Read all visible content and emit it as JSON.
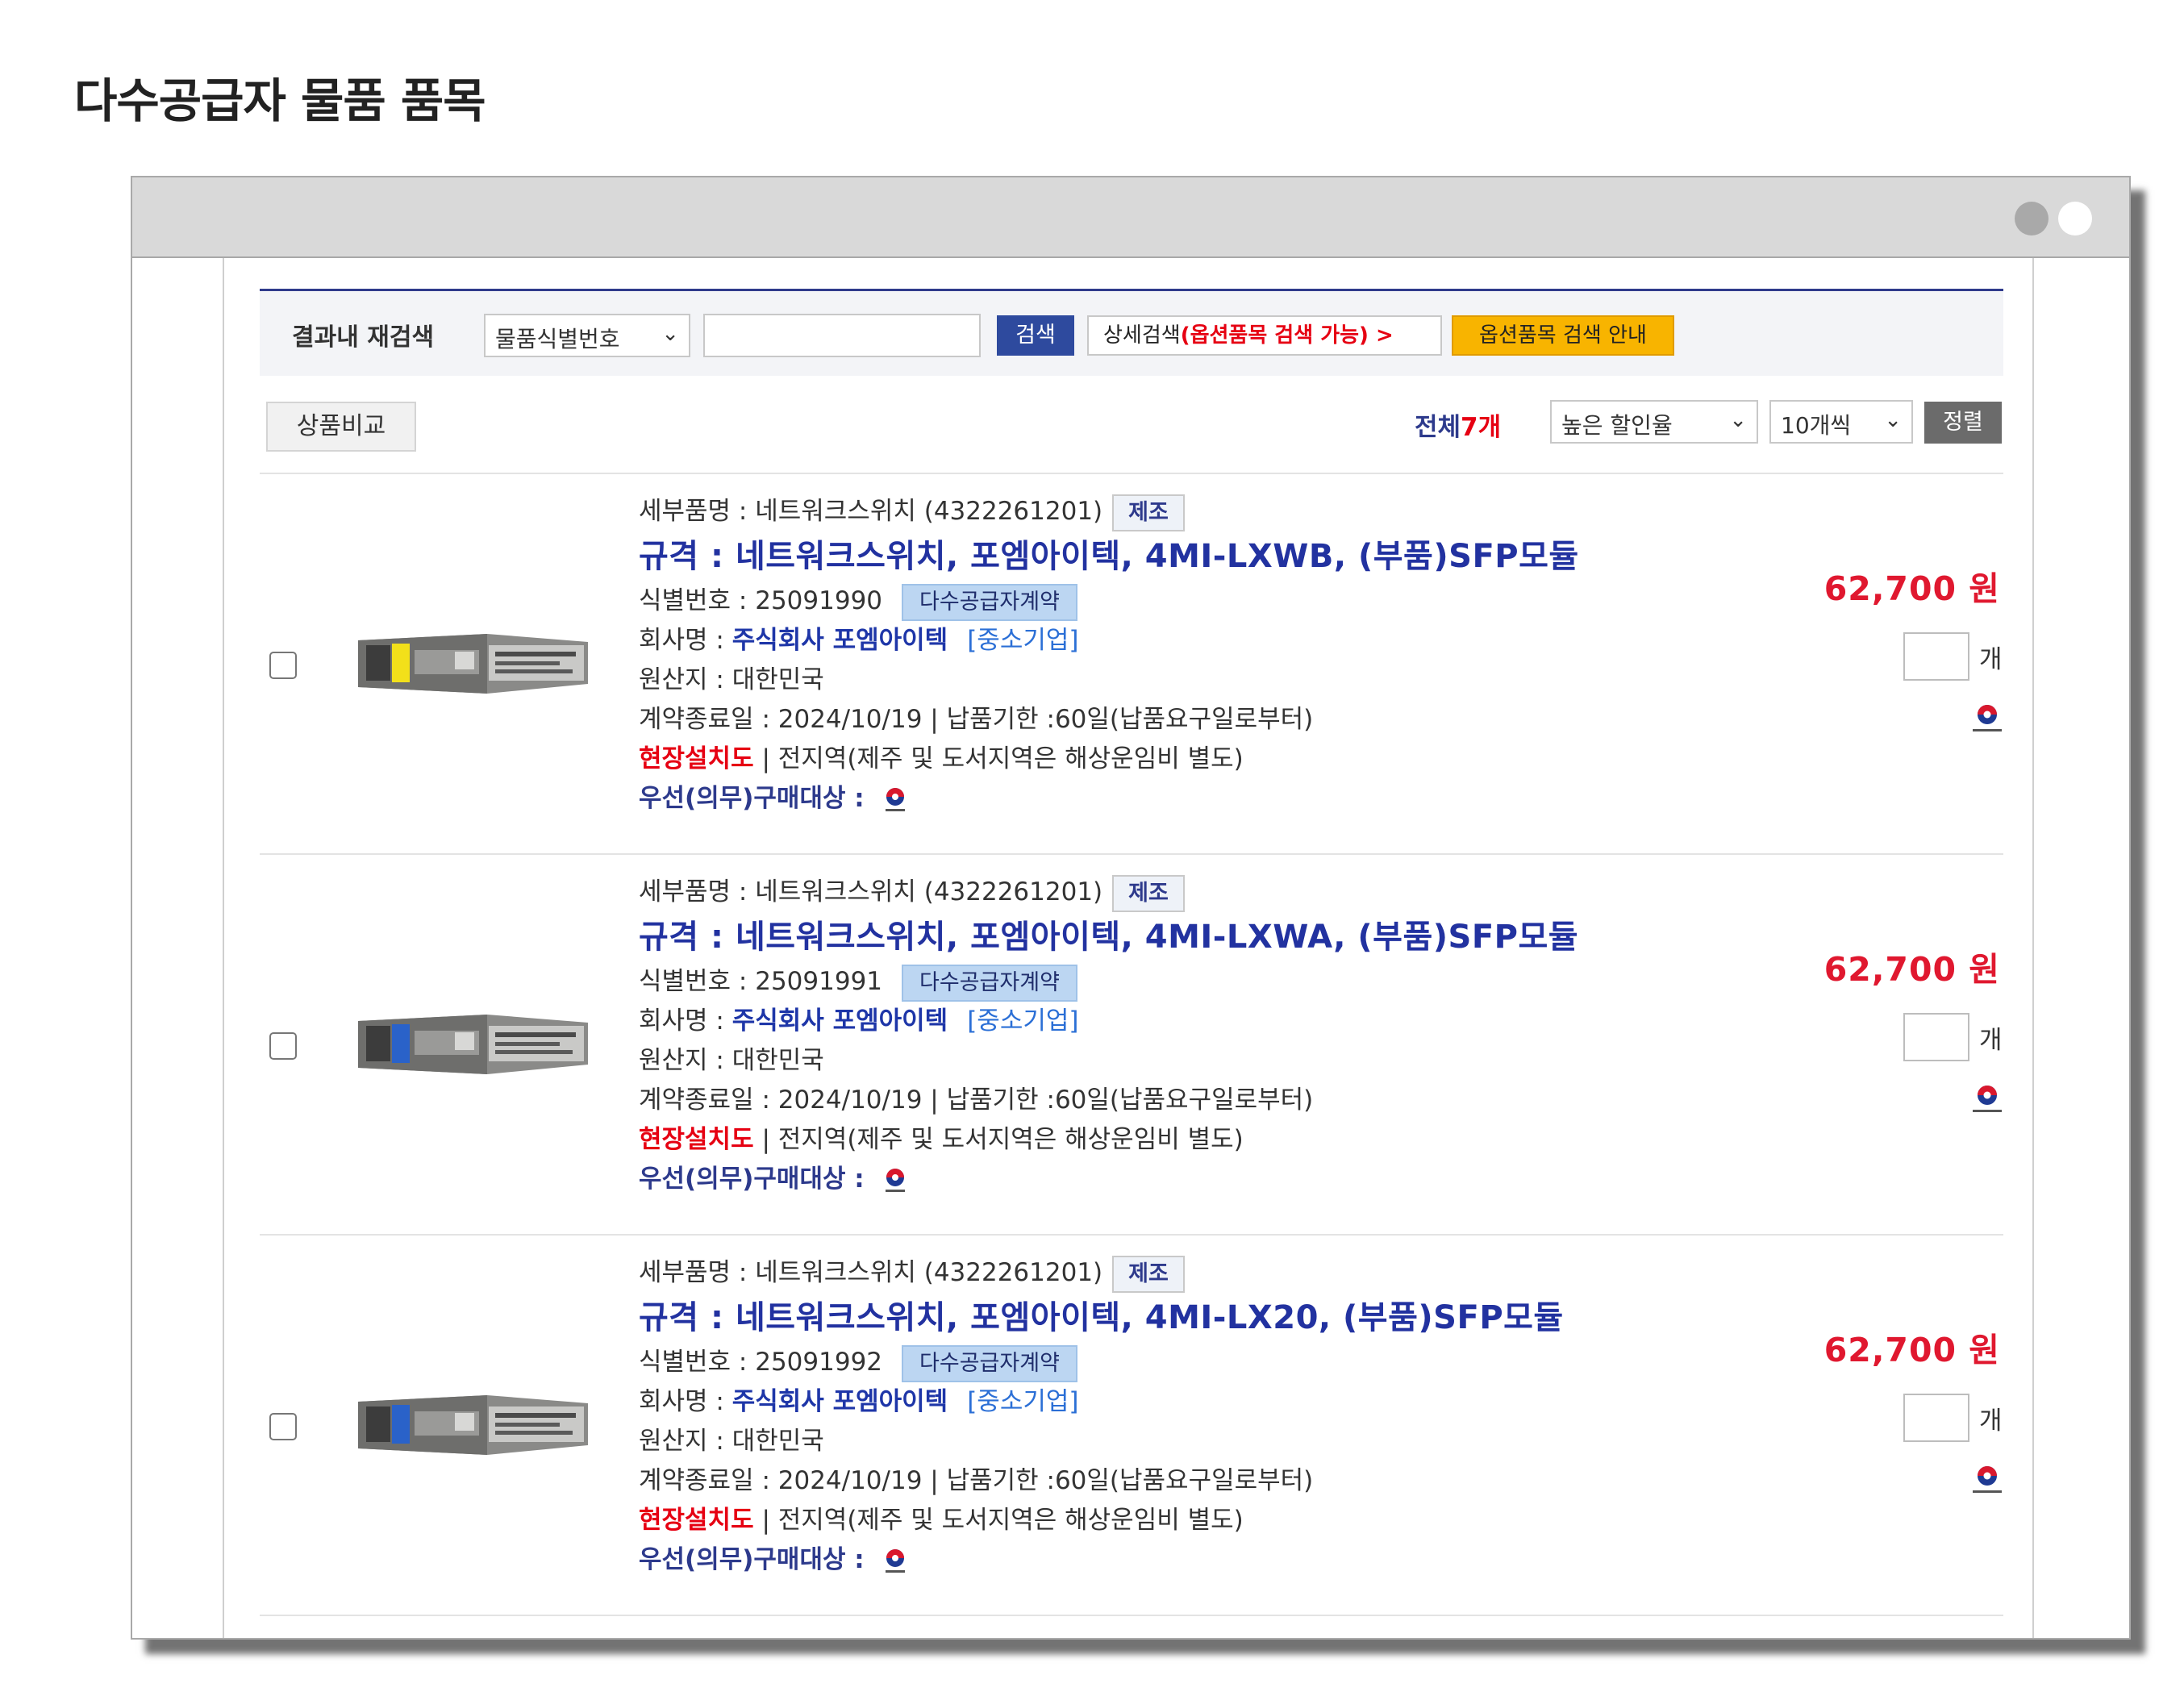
{
  "page_title": "다수공급자 물품 품목",
  "search": {
    "label": "결과내 재검색",
    "field_select": "물품식별번호",
    "input_value": "",
    "search_button": "검색",
    "detail_button_prefix": "상세검색",
    "detail_button_red": "(옵션품목 검색 가능) >",
    "guide_button": "옵션품목 검색 안내"
  },
  "toolbar": {
    "compare_button": "상품비교",
    "total_label": "전체",
    "total_count": "7개",
    "sort_select": "높은 할인율",
    "per_page_select": "10개씩",
    "sort_button": "정렬"
  },
  "colors": {
    "spec_blue": "#2232a0",
    "price_red": "#e0182f",
    "search_blue": "#2e4a9e",
    "guide_yellow": "#f8b400"
  },
  "items": [
    {
      "detail_name": "세부품명 : 네트워크스위치 (4322261201)",
      "mfg_tag": "제조",
      "spec": "규격 : 네트워크스위치, 포엠아이텍, 4MI-LXWB, (부품)SFP모듈",
      "id_label": "식별번호 : 25091990",
      "contract_tag": "다수공급자계약",
      "company_label": "회사명 : ",
      "company_name": "주식회사 포엠아이텍",
      "company_type": "[중소기업]",
      "origin": "원산지 : 대한민국",
      "contract_info": "계약종료일 : 2024/10/19 | 납품기한 :60일(납품요구일로부터)",
      "install_label": "현장설치도",
      "install_info": " | 전지역(제주 및 도서지역은 해상운임비 별도)",
      "pref_label": "우선(의무)구매대상 :",
      "price": "62,700 원",
      "qty_unit": "개",
      "stripe_color": "#f2e01a"
    },
    {
      "detail_name": "세부품명 : 네트워크스위치 (4322261201)",
      "mfg_tag": "제조",
      "spec": "규격 : 네트워크스위치, 포엠아이텍, 4MI-LXWA, (부품)SFP모듈",
      "id_label": "식별번호 : 25091991",
      "contract_tag": "다수공급자계약",
      "company_label": "회사명 : ",
      "company_name": "주식회사 포엠아이텍",
      "company_type": "[중소기업]",
      "origin": "원산지 : 대한민국",
      "contract_info": "계약종료일 : 2024/10/19 | 납품기한 :60일(납품요구일로부터)",
      "install_label": "현장설치도",
      "install_info": " | 전지역(제주 및 도서지역은 해상운임비 별도)",
      "pref_label": "우선(의무)구매대상 :",
      "price": "62,700 원",
      "qty_unit": "개",
      "stripe_color": "#2a62c9"
    },
    {
      "detail_name": "세부품명 : 네트워크스위치 (4322261201)",
      "mfg_tag": "제조",
      "spec": "규격 : 네트워크스위치, 포엠아이텍, 4MI-LX20, (부품)SFP모듈",
      "id_label": "식별번호 : 25091992",
      "contract_tag": "다수공급자계약",
      "company_label": "회사명 : ",
      "company_name": "주식회사 포엠아이텍",
      "company_type": "[중소기업]",
      "origin": "원산지 : 대한민국",
      "contract_info": "계약종료일 : 2024/10/19 | 납품기한 :60일(납품요구일로부터)",
      "install_label": "현장설치도",
      "install_info": " | 전지역(제주 및 도서지역은 해상운임비 별도)",
      "pref_label": "우선(의무)구매대상 :",
      "price": "62,700 원",
      "qty_unit": "개",
      "stripe_color": "#2a62c9"
    }
  ]
}
